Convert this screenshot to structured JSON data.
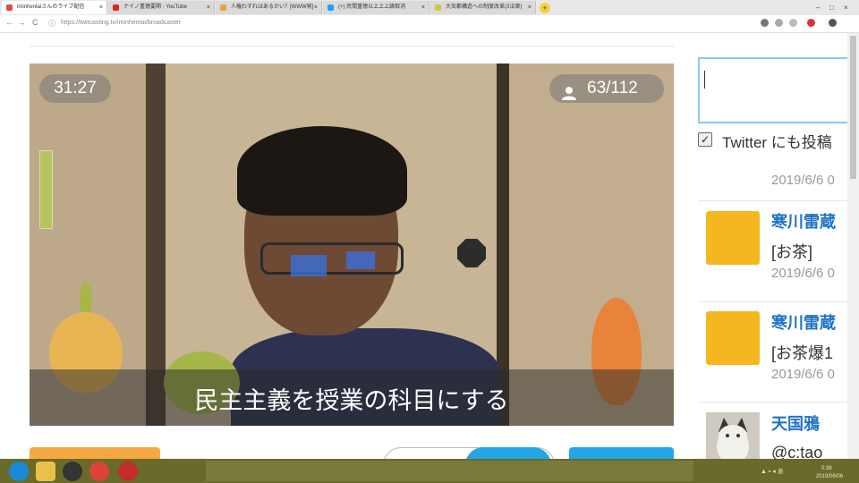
{
  "browser": {
    "tabs": [
      {
        "title": "iminhentaiさんのライブ配信",
        "fav_color": "#e64646",
        "active": true
      },
      {
        "title": "ナイノ重徳要関 - YouTube",
        "fav_color": "#e62117",
        "active": false
      },
      {
        "title": "人権わすれはあるかい？[WWW発]",
        "fav_color": "#e8a33a",
        "active": false
      },
      {
        "title": "(+) 民間重徳以上上上論取消",
        "fav_color": "#1da1f2",
        "active": false
      },
      {
        "title": "大気都構造への制度改革(3法案)",
        "fav_color": "#c9c93a",
        "active": false
      }
    ],
    "new_tab_label": "+",
    "window_controls": [
      "–",
      "□",
      "×"
    ],
    "back_label": "←",
    "forward_label": "→",
    "reload_label": "C",
    "url": "https://twitcasting.tv/iminhentai/broadcaster"
  },
  "player": {
    "elapsed": "31:27",
    "viewers": "63/112",
    "caption": "民主主義を授業の科目にする"
  },
  "sidebar": {
    "twitter_label": "Twitter にも投稿",
    "comments": [
      {
        "date": "2019/6/6 0"
      },
      {
        "name": "寒川雷蔵",
        "text": "[お茶]",
        "date": "2019/6/6 0",
        "avatar_color": "#f5b720"
      },
      {
        "name": "寒川雷蔵",
        "text": "[お茶爆1",
        "date": "2019/6/6 0",
        "avatar_color": "#f5b720"
      },
      {
        "name": "天国鴉",
        "text": "@c:tao",
        "avatar_color": "#cfcac0"
      }
    ]
  },
  "colors": {
    "accent_orange": "#f7a843",
    "accent_blue": "#23a6e8",
    "taskbar": "#6a6a2a"
  },
  "taskbar": {
    "time": "0:38",
    "date": "2019/06/06"
  }
}
